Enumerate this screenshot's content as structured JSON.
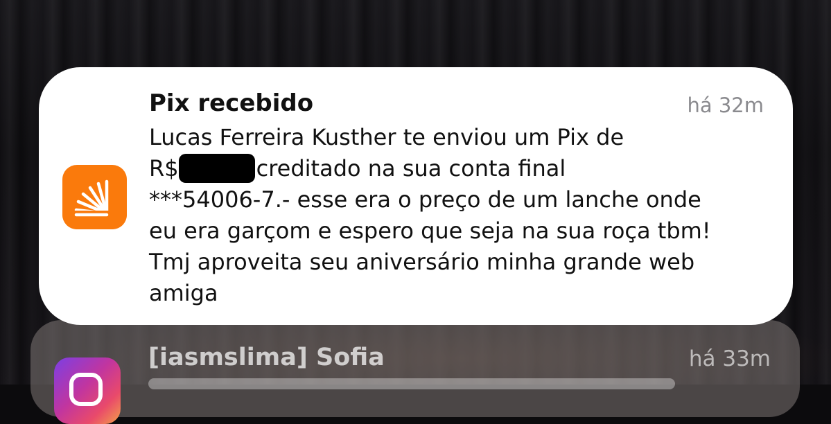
{
  "notifications": [
    {
      "app_icon": "orange-sunburst-bank-icon",
      "title": "Pix recebido",
      "time": "há 32m",
      "body_lines": [
        "Lucas Ferreira Kusther te enviou um Pix de",
        "R$",
        "creditado na sua conta final",
        "***54006-7.- esse era o preço de um lanche onde",
        "eu era garçom e espero que seja na sua roça tbm!",
        "Tmj aproveita seu aniversário minha grande web",
        "amiga"
      ],
      "accent_color": "#fa7a0c"
    },
    {
      "app_icon": "instagram-icon",
      "title": "[iasmslima] Sofia",
      "time": "há 33m"
    }
  ]
}
